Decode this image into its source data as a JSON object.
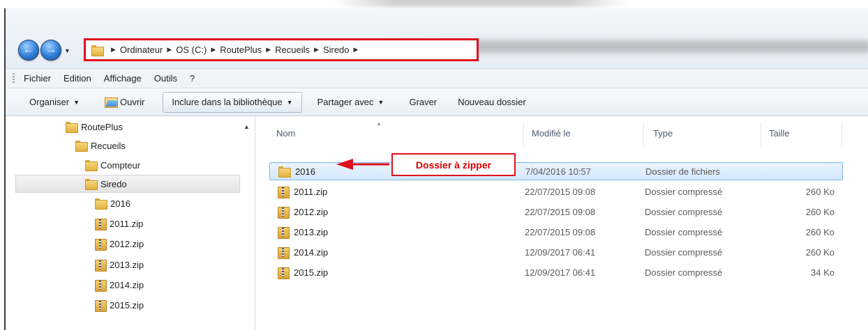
{
  "address_bar": {
    "crumbs": [
      "Ordinateur",
      "OS (C:)",
      "RoutePlus",
      "Recueils",
      "Siredo"
    ]
  },
  "menu": {
    "items": [
      "Fichier",
      "Edition",
      "Affichage",
      "Outils",
      "?"
    ]
  },
  "toolbar": {
    "organiser": "Organiser",
    "ouvrir": "Ouvrir",
    "inclure": "Inclure dans la bibliothèque",
    "partager": "Partager avec",
    "graver": "Graver",
    "nouveau_dossier": "Nouveau dossier"
  },
  "nav_tree": [
    {
      "label": "RoutePlus",
      "icon": "folder-icon",
      "selected": false
    },
    {
      "label": "Recueils",
      "icon": "folder-icon",
      "selected": false
    },
    {
      "label": "Compteur",
      "icon": "folder-icon",
      "selected": false
    },
    {
      "label": "Siredo",
      "icon": "folder-icon",
      "selected": true
    },
    {
      "label": "2016",
      "icon": "folder-icon",
      "selected": false
    },
    {
      "label": "2011.zip",
      "icon": "zip-folder-icon",
      "selected": false
    },
    {
      "label": "2012.zip",
      "icon": "zip-folder-icon",
      "selected": false
    },
    {
      "label": "2013.zip",
      "icon": "zip-folder-icon",
      "selected": false
    },
    {
      "label": "2014.zip",
      "icon": "zip-folder-icon",
      "selected": false
    },
    {
      "label": "2015.zip",
      "icon": "zip-folder-icon",
      "selected": false
    }
  ],
  "columns": {
    "name": "Nom",
    "modified": "Modifié le",
    "type": "Type",
    "size": "Taille"
  },
  "files": [
    {
      "name": "2016",
      "icon": "folder-icon",
      "modified": "7/04/2016 10:57",
      "type": "Dossier de fichiers",
      "size": "",
      "selected": true
    },
    {
      "name": "2011.zip",
      "icon": "zip-folder-icon",
      "modified": "22/07/2015 09:08",
      "type": "Dossier compressé",
      "size": "260 Ko",
      "selected": false
    },
    {
      "name": "2012.zip",
      "icon": "zip-folder-icon",
      "modified": "22/07/2015 09:08",
      "type": "Dossier compressé",
      "size": "260 Ko",
      "selected": false
    },
    {
      "name": "2013.zip",
      "icon": "zip-folder-icon",
      "modified": "22/07/2015 09:08",
      "type": "Dossier compressé",
      "size": "260 Ko",
      "selected": false
    },
    {
      "name": "2014.zip",
      "icon": "zip-folder-icon",
      "modified": "12/09/2017 06:41",
      "type": "Dossier compressé",
      "size": "260 Ko",
      "selected": false
    },
    {
      "name": "2015.zip",
      "icon": "zip-folder-icon",
      "modified": "12/09/2017 06:41",
      "type": "Dossier compressé",
      "size": "34 Ko",
      "selected": false
    }
  ],
  "annotation": {
    "label": "Dossier à zipper",
    "color": "#e0101e"
  }
}
